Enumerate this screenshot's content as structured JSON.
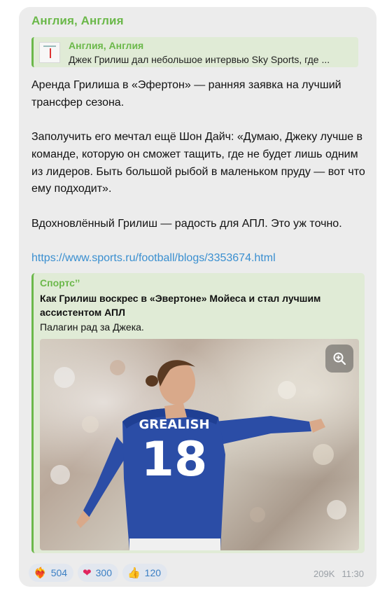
{
  "channel": {
    "name": "Англия, Англия"
  },
  "reply": {
    "title": "Англия, Англия",
    "text": "Джек Грилиш дал небольшое интервью Sky Sports, где ..."
  },
  "message": {
    "paragraph1": "Аренда Грилиша в «Эфертон» — ранняя заявка на лучший трансфер сезона.",
    "paragraph2": "Заполучить его мечтал ещё Шон Дайч: «Думаю, Джеку лучше в команде, которую он сможет тащить, где не будет лишь одним из лидеров. Быть большой рыбой в маленьком пруду — вот что ему подходит».",
    "paragraph3": "Вдохновлённый Грилиш — радость для АПЛ. Это уж точно.",
    "link": "https://www.sports.ru/football/blogs/3353674.html"
  },
  "link_preview": {
    "site": "Спортс’’",
    "title": "Как Грилиш воскрес в «Эвертоне» Мойеса и стал лучшим ассистентом АПЛ",
    "description": "Палагин рад за Джека.",
    "image": {
      "jersey_name": "GREALISH",
      "jersey_number": "18",
      "shirt_color": "#2b4da6"
    },
    "zoom_icon": "zoom-in-icon"
  },
  "reactions": [
    {
      "emoji": "❤‍🔥",
      "icon": "heart-on-fire-icon",
      "count": "504"
    },
    {
      "emoji": "❤",
      "icon": "heart-icon",
      "count": "300"
    },
    {
      "emoji": "👍",
      "icon": "thumbs-up-icon",
      "count": "120"
    }
  ],
  "meta": {
    "views": "209K",
    "time": "11:30"
  },
  "colors": {
    "accent": "#6bb84a",
    "link": "#3a8fd0",
    "bubble": "#ececec",
    "reaction_bg": "#e2e7ef",
    "reaction_count": "#3b7fc4"
  }
}
